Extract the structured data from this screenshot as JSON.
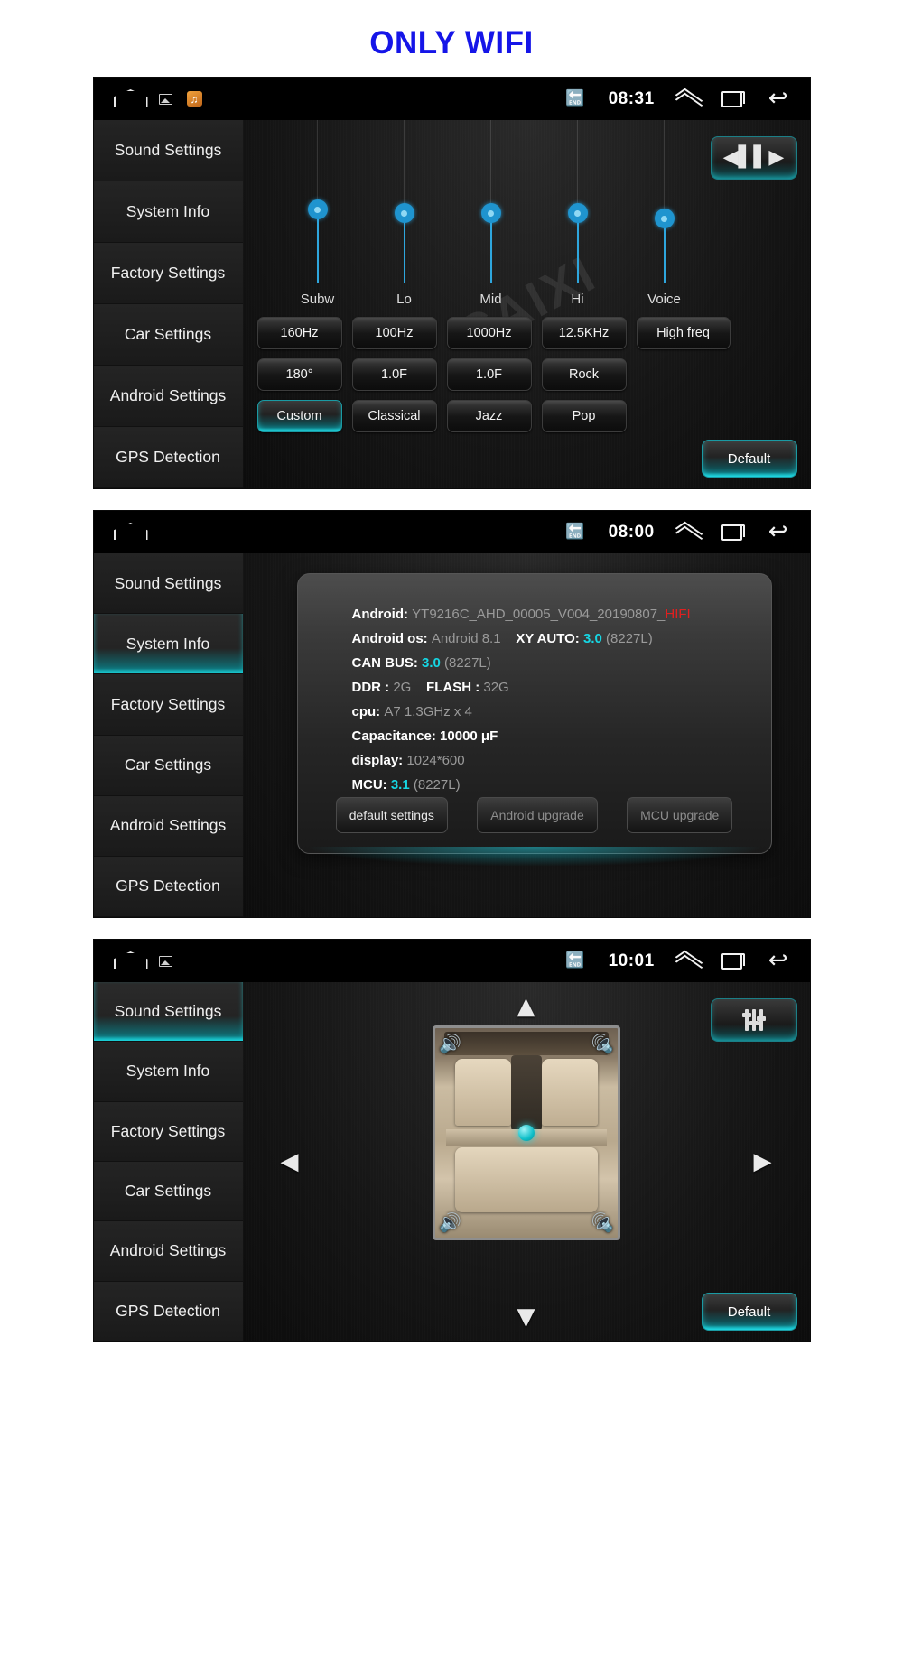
{
  "page": {
    "title": "ONLY WIFI",
    "title_color": "#1515e8",
    "watermark": "CAIXI"
  },
  "sidebar": {
    "items": [
      {
        "label": "Sound Settings"
      },
      {
        "label": "System Info"
      },
      {
        "label": "Factory Settings"
      },
      {
        "label": "Car Settings"
      },
      {
        "label": "Android Settings"
      },
      {
        "label": "GPS Detection"
      }
    ]
  },
  "screens": [
    {
      "name": "sound-settings-equalizer",
      "statusbar": {
        "time": "08:31",
        "icons": [
          "home-icon",
          "picture-icon",
          "music-icon",
          "bluetooth-icon",
          "chevron-up-icon",
          "recents-icon",
          "back-icon"
        ]
      },
      "active_sidebar_index": -1,
      "equalizer": {
        "bands": [
          {
            "label": "Subw",
            "value_pct": 48
          },
          {
            "label": "Lo",
            "value_pct": 50
          },
          {
            "label": "Mid",
            "value_pct": 50
          },
          {
            "label": "Hi",
            "value_pct": 50
          },
          {
            "label": "Voice",
            "value_pct": 52
          }
        ],
        "row1": [
          "160Hz",
          "100Hz",
          "1000Hz",
          "12.5KHz",
          "High freq"
        ],
        "row2": [
          "180°",
          "1.0F",
          "1.0F",
          "Rock"
        ],
        "row3": [
          "Custom",
          "Classical",
          "Jazz",
          "Pop"
        ],
        "active_preset": "Custom",
        "default_label": "Default",
        "toggle_icon": "speaker-balance-icon"
      }
    },
    {
      "name": "system-info",
      "statusbar": {
        "time": "08:00"
      },
      "active_sidebar_index": 1,
      "info": {
        "lines": [
          {
            "key": "Android:",
            "value": "YT9216C_AHD_00005_V004_20190807_",
            "suffix": "HIFI",
            "suffix_color": "#e02020"
          },
          {
            "key": "Android os:",
            "value": "Android 8.1",
            "key2": "XY AUTO:",
            "value2": "3.0",
            "value2_color": "#16d6e3",
            "paren2": "(8227L)"
          },
          {
            "key": "CAN BUS:",
            "value": "3.0",
            "value_color": "#16d6e3",
            "paren": "(8227L)"
          },
          {
            "key": "DDR :",
            "value": "2G",
            "key2": "FLASH :",
            "value2": "32G"
          },
          {
            "key": "cpu:",
            "value": "A7 1.3GHz x 4"
          },
          {
            "key": "Capacitance:",
            "value": "10000 μF",
            "value_white": true
          },
          {
            "key": "display:",
            "value": "1024*600"
          },
          {
            "key": "MCU:",
            "value": "3.1",
            "value_color": "#16d6e3",
            "paren": "(8227L)"
          }
        ],
        "buttons": [
          "default settings",
          "Android upgrade",
          "MCU upgrade"
        ]
      }
    },
    {
      "name": "sound-settings-fader",
      "statusbar": {
        "time": "10:01"
      },
      "active_sidebar_index": 0,
      "fader": {
        "arrows": [
          "up-arrow-icon",
          "down-arrow-icon",
          "left-arrow-icon",
          "right-arrow-icon"
        ],
        "default_label": "Default",
        "toggle_icon": "equalizer-sliders-icon",
        "speakers": [
          "front-left-speaker",
          "front-right-speaker",
          "rear-left-speaker",
          "rear-right-speaker"
        ]
      }
    }
  ]
}
